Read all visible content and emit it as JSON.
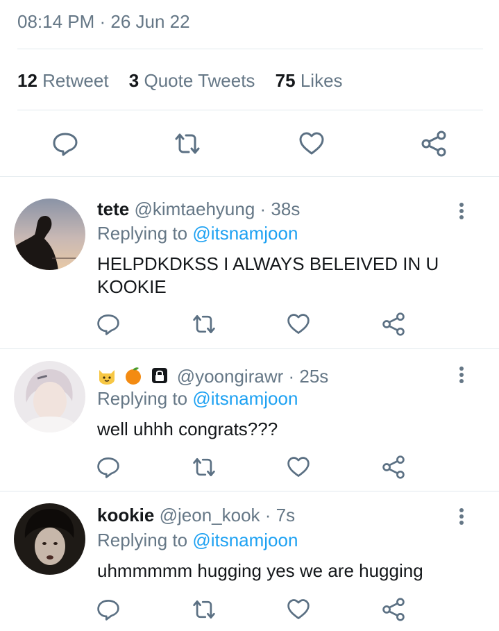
{
  "tweet": {
    "timestamp": "08:14 PM · 26 Jun 22",
    "stats": {
      "retweet_count": "12",
      "retweet_label": "Retweet",
      "quote_count": "3",
      "quote_label": "Quote Tweets",
      "likes_count": "75",
      "likes_label": "Likes"
    }
  },
  "icons": {
    "reply": "reply-icon",
    "retweet": "retweet-icon",
    "like": "heart-icon",
    "share": "share-icon",
    "more": "more-vertical-icon"
  },
  "colors": {
    "text_secondary": "#657786",
    "mention": "#1da1f2",
    "divider": "#e1e8ed"
  },
  "replies": [
    {
      "name": "tete",
      "handle": "@kimtaehyung",
      "time": "· 38s",
      "replying_prefix": "Replying to",
      "replying_to": "@itsnamjoon",
      "text": "HELPDKDKSS I ALWAYS BELEIVED IN U KOOKIE"
    },
    {
      "name": "",
      "name_emojis": [
        "cat-face-emoji",
        "tangerine-emoji",
        "lock-icon"
      ],
      "handle": "@yoongirawr",
      "time": "· 25s",
      "replying_prefix": "Replying to",
      "replying_to": "@itsnamjoon",
      "text": "well uhhh congrats???"
    },
    {
      "name": "kookie",
      "handle": "@jeon_kook",
      "time": "· 7s",
      "replying_prefix": "Replying to",
      "replying_to": "@itsnamjoon",
      "text": "uhmmmmm hugging yes we are hugging"
    }
  ]
}
